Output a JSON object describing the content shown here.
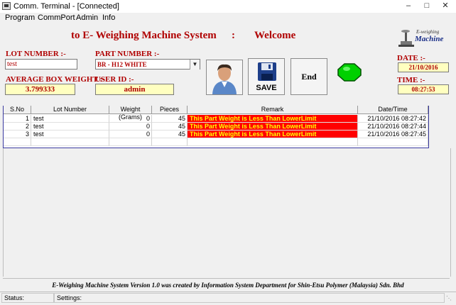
{
  "window": {
    "title": "Comm. Terminal - [Connected]",
    "minimize": "–",
    "maximize": "□",
    "close": "✕"
  },
  "menu": [
    "Program",
    "CommPort",
    "Admin",
    "Info"
  ],
  "header": {
    "title_left": "to E- Weighing Machine System",
    "separator": ":",
    "title_right": "Welcome"
  },
  "logo": {
    "line1": "E-weighing",
    "line2": "Machine"
  },
  "form": {
    "lot_label": "LOT NUMBER :-",
    "lot_value": "test",
    "part_label": "PART NUMBER :-",
    "part_value": "BR - H12 WHITE",
    "avg_label": "AVERAGE BOX WEIGHT :-",
    "avg_value": "3.799333",
    "user_label": "USER ID :-",
    "user_value": "admin",
    "date_label": "DATE :-",
    "date_value": "21/10/2016",
    "time_label": "TIME :-",
    "time_value": "08:27:53"
  },
  "buttons": {
    "save": "SAVE",
    "end": "End"
  },
  "table": {
    "headers": [
      "S.No",
      "Lot Number",
      "Weight (Grams)",
      "Pieces",
      "Remark",
      "Date/Time"
    ],
    "rows": [
      [
        "1",
        "test",
        "0",
        "45",
        "This Part Weight is Less Than LowerLimit",
        "21/10/2016  08:27:42"
      ],
      [
        "2",
        "test",
        "0",
        "45",
        "This Part Weight is Less Than LowerLimit",
        "21/10/2016  08:27:44"
      ],
      [
        "3",
        "test",
        "0",
        "45",
        "This Part Weight is Less Than LowerLimit",
        "21/10/2016  08:27:45"
      ]
    ]
  },
  "footer": "E-Weighing Machine System Version 1.0 was created by Information System Department for Shin-Etsu Polymer (Malaysia) Sdn. Bhd",
  "status": {
    "status_label": "Status:",
    "settings_label": "Settings:"
  },
  "colors": {
    "label_red": "#b00000",
    "field_yellow": "#ffffc0",
    "remark_bg": "#ff0000",
    "remark_text": "#ffff00",
    "indicator_green": "#00d000"
  }
}
